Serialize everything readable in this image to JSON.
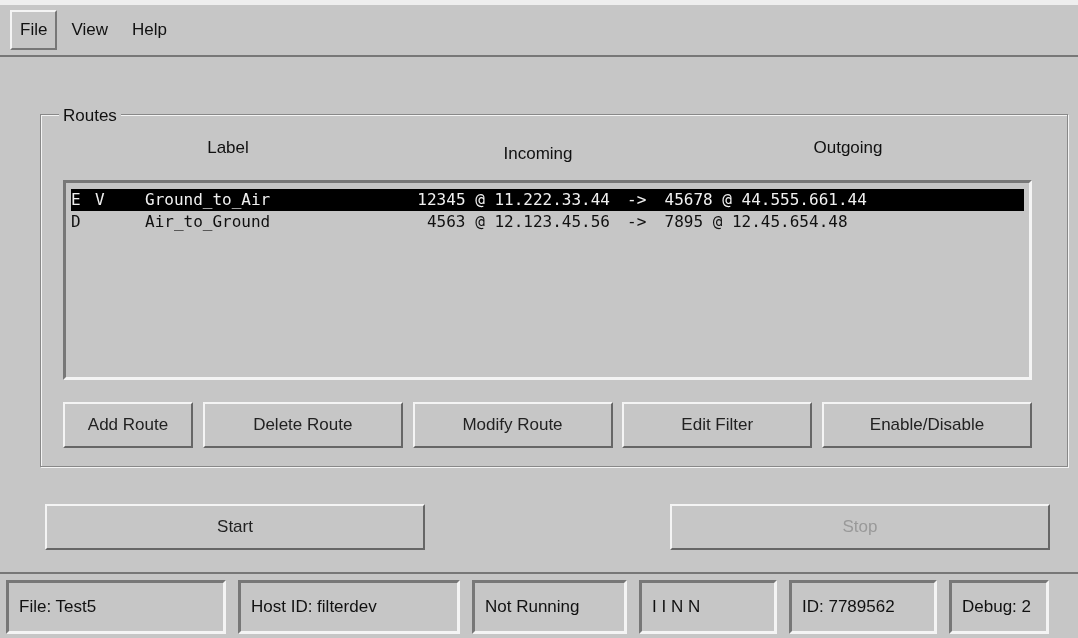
{
  "menu": [
    {
      "label": "File",
      "selected": true
    },
    {
      "label": "View",
      "selected": false
    },
    {
      "label": "Help",
      "selected": false
    }
  ],
  "routes": {
    "title": "Routes",
    "columns": [
      "Label",
      "Incoming",
      "Outgoing"
    ],
    "rows": [
      {
        "state": "E",
        "flag": "V",
        "label": "Ground_to_Air",
        "incoming": "12345 @ 11.222.33.44",
        "arrow": "->",
        "outgoing": "45678 @ 44.555.661.44",
        "selected": true
      },
      {
        "state": "D",
        "label": "Air_to_Ground",
        "incoming": "4563 @ 12.123.45.56",
        "arrow": "->",
        "outgoing": "7895 @ 12.45.654.48",
        "selected": false
      }
    ],
    "buttons": [
      "Add Route",
      "Delete Route",
      "Modify Route",
      "Edit Filter",
      "Enable/Disable"
    ]
  },
  "controls": [
    {
      "label": "Start",
      "disabled": false
    },
    {
      "label": "Stop",
      "disabled": true
    }
  ],
  "status_bar": [
    "File: Test5",
    "Host ID: filterdev",
    "Not Running",
    "I I N N",
    "ID: 7789562",
    "Debug: 2"
  ]
}
